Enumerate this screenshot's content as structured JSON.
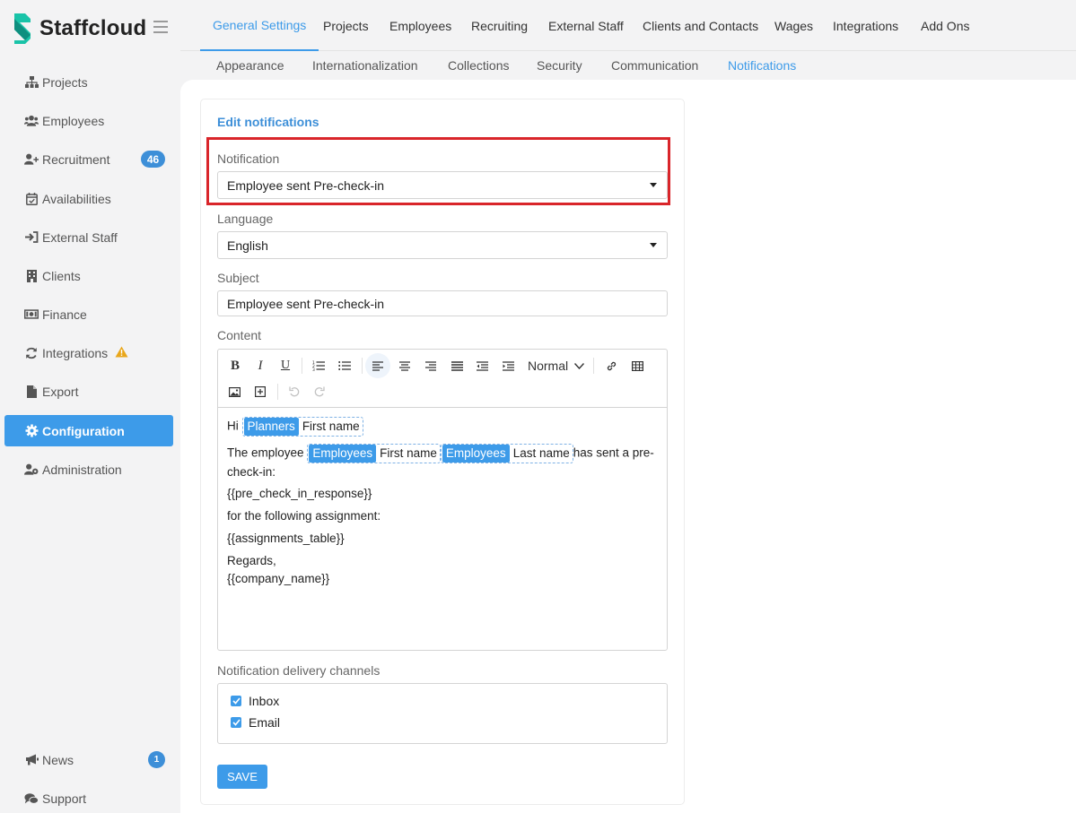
{
  "app": {
    "name": "Staffcloud",
    "brand_color": "#3d9be9"
  },
  "sidebar": {
    "items": [
      {
        "label": "Projects",
        "icon": "sitemap-icon"
      },
      {
        "label": "Employees",
        "icon": "users-icon"
      },
      {
        "label": "Recruitment",
        "icon": "user-plus-icon",
        "badge": "46"
      },
      {
        "label": "Availabilities",
        "icon": "calendar-check-icon"
      },
      {
        "label": "External Staff",
        "icon": "sign-in-icon"
      },
      {
        "label": "Clients",
        "icon": "building-icon"
      },
      {
        "label": "Finance",
        "icon": "money-icon"
      },
      {
        "label": "Integrations",
        "icon": "sync-icon",
        "warning": "warning-icon"
      },
      {
        "label": "Export",
        "icon": "file-icon"
      },
      {
        "label": "Configuration",
        "icon": "gear-icon",
        "active": true
      },
      {
        "label": "Administration",
        "icon": "user-cog-icon"
      }
    ],
    "bottom": [
      {
        "label": "News",
        "icon": "megaphone-icon",
        "badge": "1"
      },
      {
        "label": "Support",
        "icon": "comments-icon"
      }
    ]
  },
  "topnav": {
    "tabs": [
      "General Settings",
      "Projects",
      "Employees",
      "Recruiting",
      "External Staff",
      "Clients and Contacts",
      "Wages",
      "Integrations",
      "Add Ons"
    ],
    "active": "General Settings"
  },
  "subnav": {
    "tabs": [
      "Appearance",
      "Internationalization",
      "Collections",
      "Security",
      "Communication",
      "Notifications"
    ],
    "active": "Notifications"
  },
  "form": {
    "title": "Edit notifications",
    "notification": {
      "label": "Notification",
      "value": "Employee sent Pre-check-in"
    },
    "language": {
      "label": "Language",
      "value": "English"
    },
    "subject": {
      "label": "Subject",
      "value": "Employee sent Pre-check-in"
    },
    "content": {
      "label": "Content",
      "style_dropdown": "Normal",
      "greeting": "Hi",
      "token1": {
        "tag": "Planners",
        "field": "First name"
      },
      "line2_prefix": "The employee",
      "token2": {
        "tag": "Employees",
        "field": "First name"
      },
      "token3": {
        "tag": "Employees",
        "field": "Last name"
      },
      "line2_suffix": "has sent a pre-check-in:",
      "line3": "{{pre_check_in_response}}",
      "line4": "for the following assignment:",
      "line5": "{{assignments_table}}",
      "line6": "Regards,",
      "line7": "{{company_name}}"
    },
    "channels": {
      "label": "Notification delivery channels",
      "options": [
        {
          "label": "Inbox",
          "checked": true
        },
        {
          "label": "Email",
          "checked": true
        }
      ]
    },
    "save_label": "SAVE"
  }
}
